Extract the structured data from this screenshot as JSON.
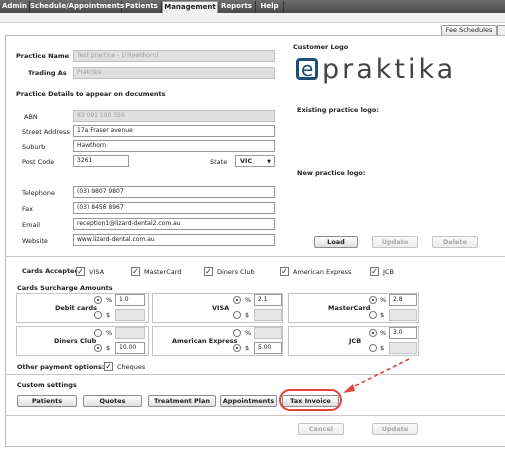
{
  "nav": {
    "tabs": [
      "Admin",
      "Schedule/Appointments",
      "Patients",
      "Management",
      "Reports",
      "Help"
    ],
    "active": "Management"
  },
  "fee_schedules_label": "Fee Schedules",
  "practice": {
    "name_label": "Practice Name",
    "name_value": "Test practice - 1(Hawthorn)",
    "trading_label": "Trading As",
    "trading_value": "Praktika",
    "details_heading": "Practice Details to appear on documents",
    "abn_label": "ABN",
    "abn_value": "83 091 190 359",
    "street_label": "Street Address",
    "street_value": "17a Fraser avenue",
    "suburb_label": "Suburb",
    "suburb_value": "Hawthorn",
    "postcode_label": "Post Code",
    "postcode_value": "3261",
    "state_label": "State",
    "state_value": "VIC",
    "telephone_label": "Telephone",
    "telephone_value": "(03) 9807 9807",
    "fax_label": "Fax",
    "fax_value": "(03) 8456 8967",
    "email_label": "Email",
    "email_value": "reception1@lizard-dental2.com.au",
    "website_label": "Website",
    "website_value": "www.lizard-dental.com.au"
  },
  "logo": {
    "customer_logo_label": "Customer Logo",
    "brand_text": "praktika",
    "existing_label": "Existing practice logo:",
    "new_label": "New practice logo:",
    "load": "Load",
    "update": "Update",
    "delete": "Delete"
  },
  "cards": {
    "accepted_label": "Cards Accepted",
    "items": [
      "VISA",
      "MasterCard",
      "Diners Club",
      "American Express",
      "JCB"
    ],
    "surcharge_label": "Cards Surcharge Amounts",
    "percent": "%",
    "dollar": "$",
    "debit_label": "Debit cards",
    "debit_pct": "1.0",
    "visa_label": "VISA",
    "visa_pct": "2.1",
    "mastercard_label": "MasterCard",
    "mastercard_pct": "2.8",
    "diners_label": "Diners Club",
    "diners_dollar": "10.00",
    "amex_label": "American Express",
    "amex_dollar": "5.00",
    "jcb_label": "JCB",
    "jcb_pct": "3.0"
  },
  "other_payment": {
    "label": "Other payment options:",
    "cheques": "Cheques"
  },
  "custom": {
    "heading": "Custom settings",
    "buttons": [
      "Patients",
      "Quotes",
      "Treatment Plan",
      "Appointments",
      "Tax Invoice"
    ]
  },
  "footer": {
    "cancel": "Cancel",
    "update": "Update"
  },
  "check_mark": "✓",
  "arrow_down": "▼",
  "colors": {
    "highlight": "#e0443a",
    "brand_blue": "#1a4f7a"
  }
}
